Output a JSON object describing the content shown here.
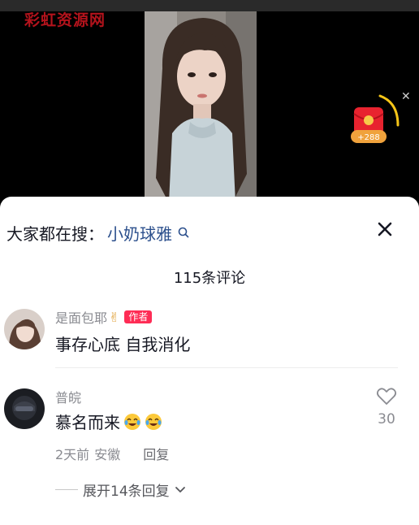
{
  "watermark": "彩虹资源网",
  "red_packet": {
    "amount": "+288",
    "icon": "red-envelope-icon",
    "accent": "#f5c518",
    "color": "#e8232f"
  },
  "panel": {
    "search_prefix": "大家都在搜：",
    "search_term": "小奶球雅",
    "comment_count": "115条评论"
  },
  "comments": [
    {
      "username": "是面包耶",
      "username_emoji": "✌",
      "badge": "作者",
      "text": "事存心底 自我消化"
    },
    {
      "username": "普皖",
      "text": "慕名而来",
      "emojis": [
        "crying-laughing-emoji",
        "crying-laughing-emoji"
      ],
      "meta_time": "2天前",
      "meta_location": "安徽",
      "reply_label": "回复",
      "like_count": "30",
      "expand_label": "展开14条回复"
    }
  ],
  "colors": {
    "accent_red": "#fe2c55",
    "search_link": "#2b4f8c",
    "text_primary": "#161823",
    "text_secondary": "#8a8b91"
  }
}
